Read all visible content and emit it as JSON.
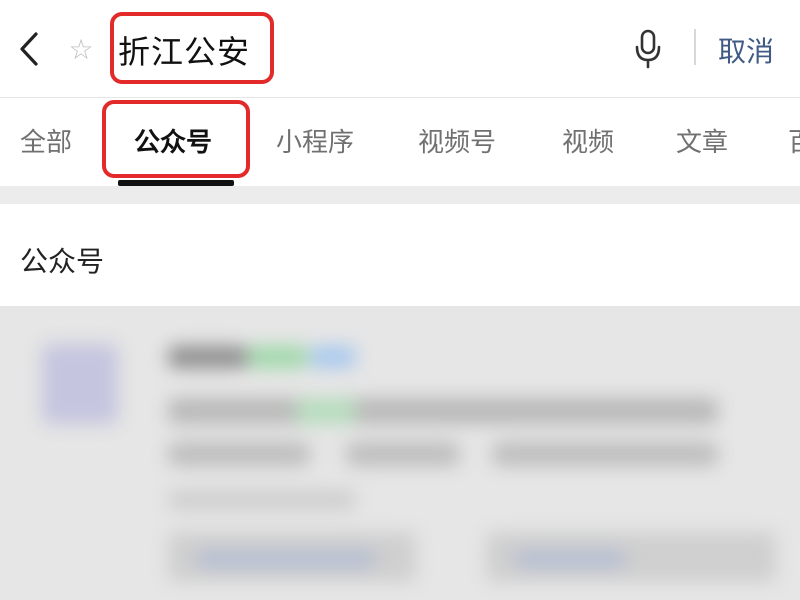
{
  "search": {
    "query": "折江公安",
    "cancel_label": "取消"
  },
  "icons": {
    "back": "chevron-left-icon",
    "star": "star-icon",
    "mic": "microphone-icon"
  },
  "tabs": [
    {
      "label": "全部",
      "active": false
    },
    {
      "label": "公众号",
      "active": true
    },
    {
      "label": "小程序",
      "active": false
    },
    {
      "label": "视频号",
      "active": false
    },
    {
      "label": "视频",
      "active": false
    },
    {
      "label": "文章",
      "active": false
    },
    {
      "label": "百",
      "active": false
    }
  ],
  "section": {
    "title": "公众号"
  },
  "colors": {
    "highlight": "#e32a2a",
    "cancel_link": "#3f5a85",
    "active_tab": "#111111",
    "inactive_tab": "#707070"
  }
}
